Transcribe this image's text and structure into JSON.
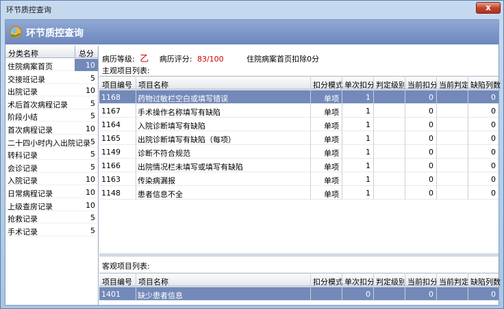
{
  "window": {
    "title": "环节质控查询",
    "close_label": "x"
  },
  "header": {
    "title": "环节质控查询"
  },
  "left": {
    "col_name": "分类名称",
    "col_score": "总分",
    "rows": [
      {
        "name": "住院病案首页",
        "score": "10"
      },
      {
        "name": "交接班记录",
        "score": "5"
      },
      {
        "name": "出院记录",
        "score": "10"
      },
      {
        "name": "术后首次病程记录",
        "score": "5"
      },
      {
        "name": "阶段小结",
        "score": "5"
      },
      {
        "name": "首次病程记录",
        "score": "10"
      },
      {
        "name": "二十四小时内入出院记录",
        "score": "5"
      },
      {
        "name": "转科记录",
        "score": "5"
      },
      {
        "name": "会诊记录",
        "score": "5"
      },
      {
        "name": "入院记录",
        "score": "10"
      },
      {
        "name": "日常病程记录",
        "score": "10"
      },
      {
        "name": "上级查房记录",
        "score": "10"
      },
      {
        "name": "抢救记录",
        "score": "5"
      },
      {
        "name": "手术记录",
        "score": "5"
      }
    ]
  },
  "info": {
    "grade_label": "病历等级:",
    "grade_value": "乙",
    "score_label": "病历评分:",
    "score_value": "83/100",
    "deduct_text": "住院病案首页扣除0分"
  },
  "subjective": {
    "label": "主观项目列表:",
    "columns": [
      "项目编号",
      "项目名称",
      "扣分模式",
      "单次扣分",
      "判定级别",
      "当前扣分",
      "当前判定",
      "缺陷列数"
    ],
    "rows": [
      {
        "id": "1168",
        "name": "药物过敏栏空白或填写错误",
        "mode": "单项",
        "single": "1",
        "level": "",
        "current": "0",
        "judge": "",
        "defects": "0"
      },
      {
        "id": "1167",
        "name": "手术操作名称填写有缺陷",
        "mode": "单项",
        "single": "1",
        "level": "",
        "current": "0",
        "judge": "",
        "defects": "0"
      },
      {
        "id": "1164",
        "name": "入院诊断填写有缺陷",
        "mode": "单项",
        "single": "1",
        "level": "",
        "current": "0",
        "judge": "",
        "defects": "0"
      },
      {
        "id": "1165",
        "name": "出院诊断填写有缺陷（每项）",
        "mode": "单项",
        "single": "1",
        "level": "",
        "current": "0",
        "judge": "",
        "defects": "0"
      },
      {
        "id": "1149",
        "name": "诊断不符合规范",
        "mode": "单项",
        "single": "1",
        "level": "",
        "current": "0",
        "judge": "",
        "defects": "0"
      },
      {
        "id": "1166",
        "name": "出院情况栏未填写或填写有缺陷",
        "mode": "单项",
        "single": "1",
        "level": "",
        "current": "0",
        "judge": "",
        "defects": "0"
      },
      {
        "id": "1163",
        "name": "传染病漏报",
        "mode": "单项",
        "single": "1",
        "level": "",
        "current": "0",
        "judge": "",
        "defects": "0"
      },
      {
        "id": "1148",
        "name": "患者信息不全",
        "mode": "单项",
        "single": "1",
        "level": "",
        "current": "0",
        "judge": "",
        "defects": "0"
      }
    ]
  },
  "objective": {
    "label": "客观项目列表:",
    "columns": [
      "项目编号",
      "项目名称",
      "扣分模式",
      "单次扣分",
      "判定级别",
      "当前扣分",
      "当前判定",
      "缺陷列数"
    ],
    "rows": [
      {
        "id": "1401",
        "name": "缺少患者信息",
        "mode": "",
        "single": "0",
        "level": "",
        "current": "0",
        "judge": "",
        "defects": "0"
      }
    ]
  },
  "colors": {
    "selection": "#7389b9",
    "header_band": "#7d97c9",
    "grade_red": "#d10000"
  }
}
